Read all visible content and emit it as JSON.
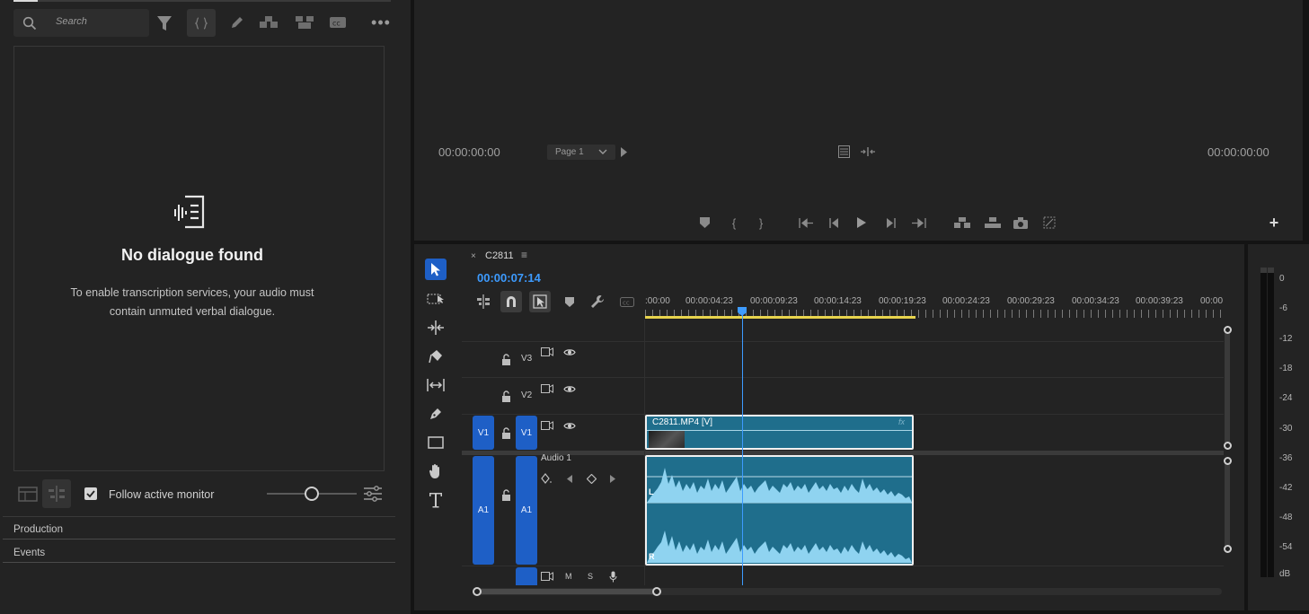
{
  "transcript_panel": {
    "search_placeholder": "Search",
    "empty_title": "No dialogue found",
    "empty_line1": "To enable transcription services, your audio must",
    "empty_line2": "contain unmuted verbal dialogue.",
    "follow_label": "Follow active monitor",
    "follow_checked": true,
    "sections": [
      "Production",
      "Events"
    ]
  },
  "program_monitor": {
    "timecode_left": "00:00:00:00",
    "timecode_right": "00:00:00:00",
    "page_select": "Page 1"
  },
  "timeline": {
    "sequence_name": "C2811",
    "current_timecode": "00:00:07:14",
    "ruler_labels": [
      ":00:00",
      "00:00:04:23",
      "00:00:09:23",
      "00:00:14:23",
      "00:00:19:23",
      "00:00:24:23",
      "00:00:29:23",
      "00:00:34:23",
      "00:00:39:23",
      "00:00"
    ],
    "video_tracks": [
      {
        "label": "V3",
        "target": ""
      },
      {
        "label": "V2",
        "target": ""
      },
      {
        "label": "V1",
        "target": "V1"
      }
    ],
    "audio_track": {
      "label": "A1",
      "target": "A1",
      "name": "Audio 1",
      "mute": "M",
      "solo": "S"
    },
    "video_clip": {
      "name": "C2811.MP4 [V]",
      "fx": "fx"
    },
    "audio_clip": {
      "left_channel": "L",
      "right_channel": "R"
    }
  },
  "audio_meter": {
    "scale": [
      "0",
      "-6",
      "-12",
      "-18",
      "-24",
      "-30",
      "-36",
      "-42",
      "-48",
      "-54",
      "dB"
    ]
  },
  "colors": {
    "accent_blue": "#1e5fc6",
    "timecode_blue": "#3d9bff",
    "clip_teal": "#1f6e8c",
    "waveform": "#8fd3f0",
    "work_area_yellow": "#e8d44d"
  }
}
